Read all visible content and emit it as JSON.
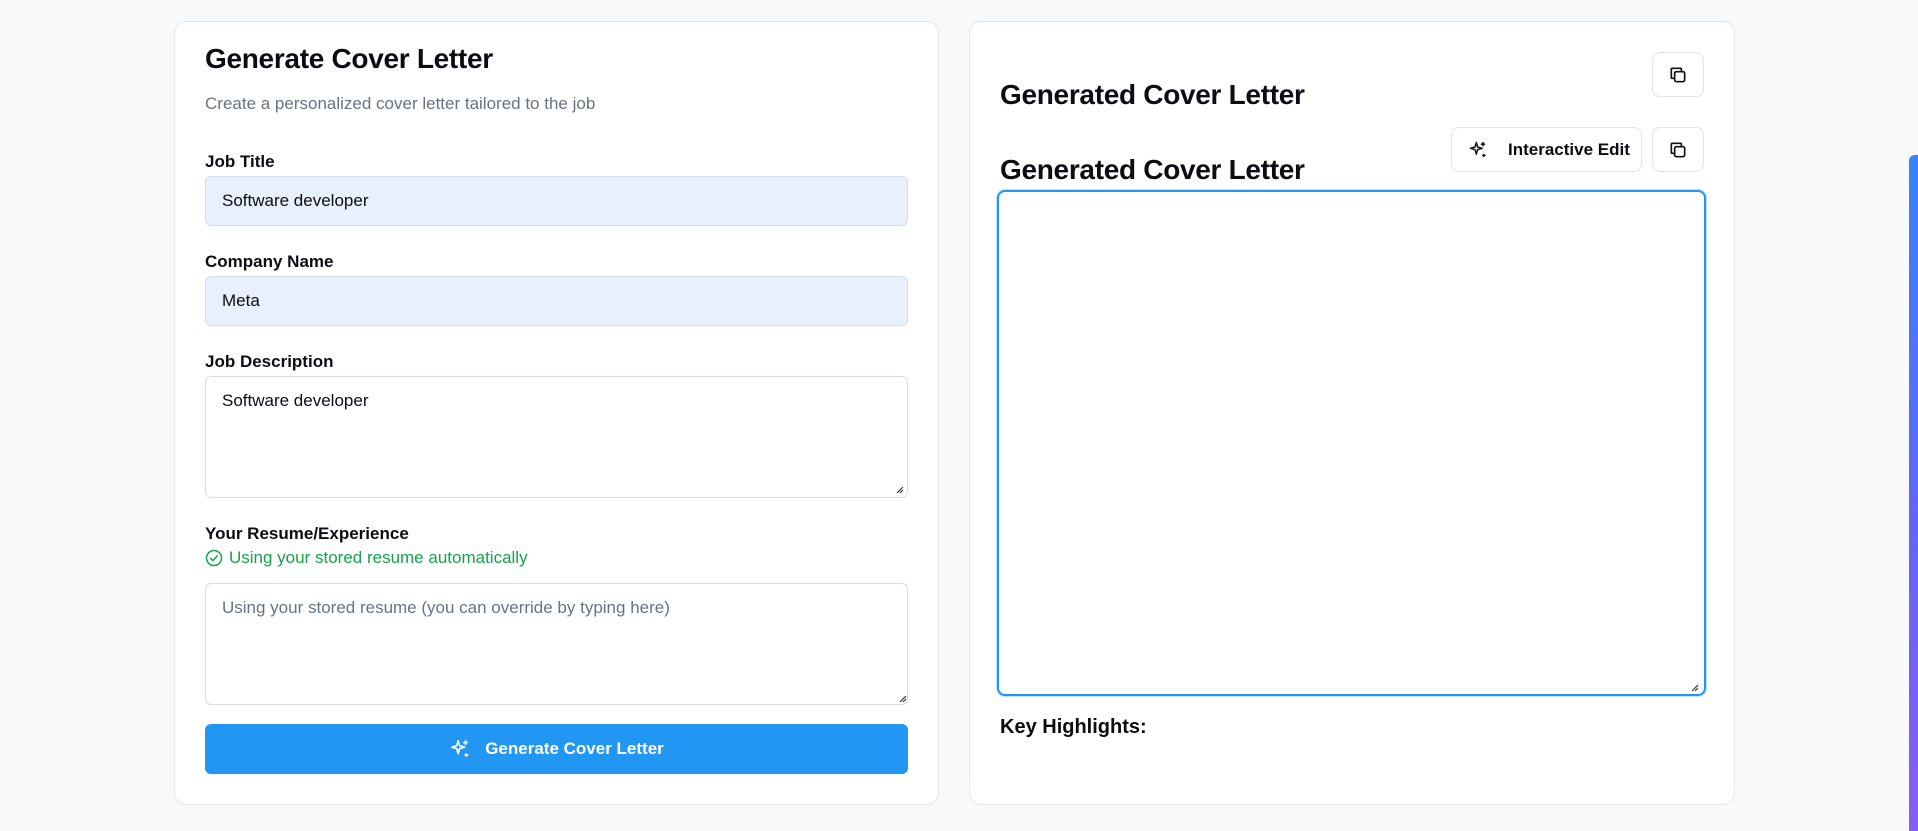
{
  "form": {
    "title": "Generate Cover Letter",
    "subtitle": "Create a personalized cover letter tailored to the job",
    "job_title": {
      "label": "Job Title",
      "value": "Software developer"
    },
    "company_name": {
      "label": "Company Name",
      "value": "Meta"
    },
    "job_description": {
      "label": "Job Description",
      "value": "Software developer"
    },
    "resume": {
      "label": "Your Resume/Experience",
      "status": "Using your stored resume automatically",
      "placeholder": "Using your stored resume (you can override by typing here)",
      "value": ""
    },
    "generate_button": "Generate Cover Letter"
  },
  "output": {
    "header_title": "Generated Cover Letter",
    "editor_title": "Generated Cover Letter",
    "interactive_edit_button": "Interactive Edit",
    "letter_text": "",
    "key_highlights_label": "Key Highlights:"
  },
  "icons": {
    "copy": "copy-icon",
    "sparkles": "sparkles-icon",
    "check_circle": "check-circle-icon"
  },
  "colors": {
    "primary": "#2196f3",
    "success": "#16a34a",
    "input_fill": "#e8f0fd"
  }
}
